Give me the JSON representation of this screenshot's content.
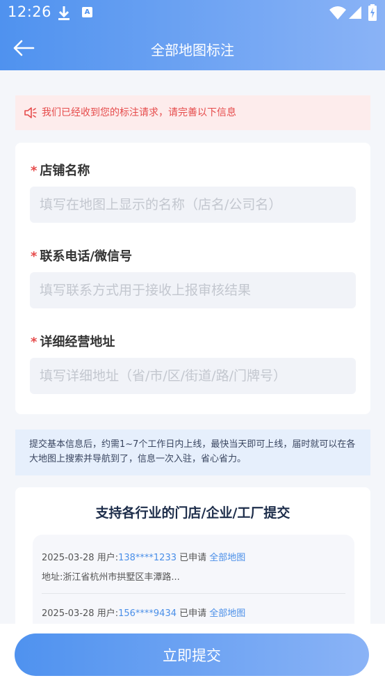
{
  "status_bar": {
    "time": "12:26",
    "badge": "A"
  },
  "header": {
    "title": "全部地图标注"
  },
  "notice": {
    "text": "我们已经收到您的标注请求，请完善以下信息"
  },
  "form": {
    "required_mark": "*",
    "fields": [
      {
        "label": "店铺名称",
        "placeholder": "填写在地图上显示的名称（店名/公司名）",
        "value": ""
      },
      {
        "label": "联系电话/微信号",
        "placeholder": "填写联系方式用于接收上报审核结果",
        "value": ""
      },
      {
        "label": "详细经营地址",
        "placeholder": "填写详细地址（省/市/区/街道/路/门牌号）",
        "value": ""
      }
    ]
  },
  "info": {
    "text": "提交基本信息后，约需1~7个工作日内上线，最快当天即可上线，届时就可以在各大地图上搜索并导航到了，信息一次入驻，省心省力。"
  },
  "records_section": {
    "title": "支持各行业的门店/企业/工厂提交",
    "records": [
      {
        "date": "2025-03-28",
        "user_label": "用户:",
        "phone": "138****1233",
        "action": "已申请",
        "product": "全部地图",
        "address": "地址:浙江省杭州市拱墅区丰潭路..."
      },
      {
        "date": "2025-03-28",
        "user_label": "用户:",
        "phone": "156****9434",
        "action": "已申请",
        "product": "全部地图",
        "address": ""
      }
    ]
  },
  "submit": {
    "label": "立即提交"
  },
  "colors": {
    "primary": "#4f92ef",
    "primary_light": "#8ab3f6",
    "alert": "#e64b4b",
    "alert_bg": "#fdecec",
    "info_bg": "#e6effc"
  }
}
